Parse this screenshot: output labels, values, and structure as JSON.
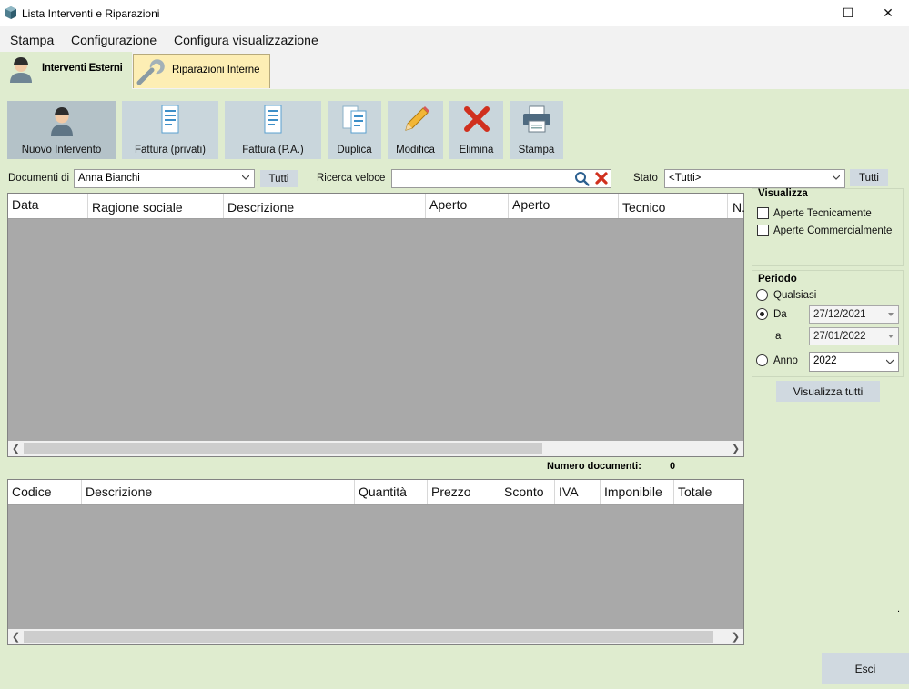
{
  "window": {
    "title": "Lista Interventi e Riparazioni",
    "minimize_glyph": "—",
    "maximize_glyph": "☐",
    "close_glyph": "✕"
  },
  "menu": [
    "Stampa",
    "Configurazione",
    "Configura visualizzazione"
  ],
  "tabs": [
    {
      "label": "Interventi Esterni",
      "icon": "technician-icon",
      "active": true
    },
    {
      "label": "Riparazioni Interne",
      "icon": "wrench-icon",
      "active": false
    }
  ],
  "toolbar": [
    {
      "label": "Nuovo Intervento",
      "icon": "technician-icon"
    },
    {
      "label": "Fattura (privati)",
      "icon": "document-icon"
    },
    {
      "label": "Fattura (P.A.)",
      "icon": "document-icon"
    },
    {
      "label": "Duplica",
      "icon": "duplicate-icon"
    },
    {
      "label": "Modifica",
      "icon": "pencil-icon"
    },
    {
      "label": "Elimina",
      "icon": "red-x-icon"
    },
    {
      "label": "Stampa",
      "icon": "printer-icon"
    }
  ],
  "filters": {
    "documenti_label": "Documenti di",
    "documenti_value": "Anna Bianchi",
    "tutti_label": "Tutti",
    "ricerca_label": "Ricerca veloce",
    "ricerca_value": "",
    "stato_label": "Stato",
    "stato_value": "<Tutti>",
    "stato_tutti_label": "Tutti"
  },
  "main_grid": {
    "columns": [
      "Data",
      "Ragione sociale",
      "Descrizione",
      "Aperto",
      "Aperto",
      "Tecnico",
      "N."
    ],
    "rows": []
  },
  "numero_documenti": {
    "label": "Numero documenti:",
    "value": "0"
  },
  "detail_grid": {
    "columns": [
      "Codice",
      "Descrizione",
      "Quantità",
      "Prezzo",
      "Sconto",
      "IVA",
      "Imponibile",
      "Totale"
    ],
    "rows": []
  },
  "visualizza": {
    "title": "Visualizza",
    "aperte_tecnicamente": "Aperte Tecnicamente",
    "aperte_commercialmente": "Aperte Commercialmente"
  },
  "periodo": {
    "title": "Periodo",
    "qualsiasi": "Qualsiasi",
    "da": "Da",
    "da_value": "27/12/2021",
    "a": "a",
    "a_value": "27/01/2022",
    "anno": "Anno",
    "anno_value": "2022",
    "selected": "da"
  },
  "visualizza_tutti_label": "Visualizza tutti",
  "esci_label": "Esci",
  "stray_dot": "."
}
